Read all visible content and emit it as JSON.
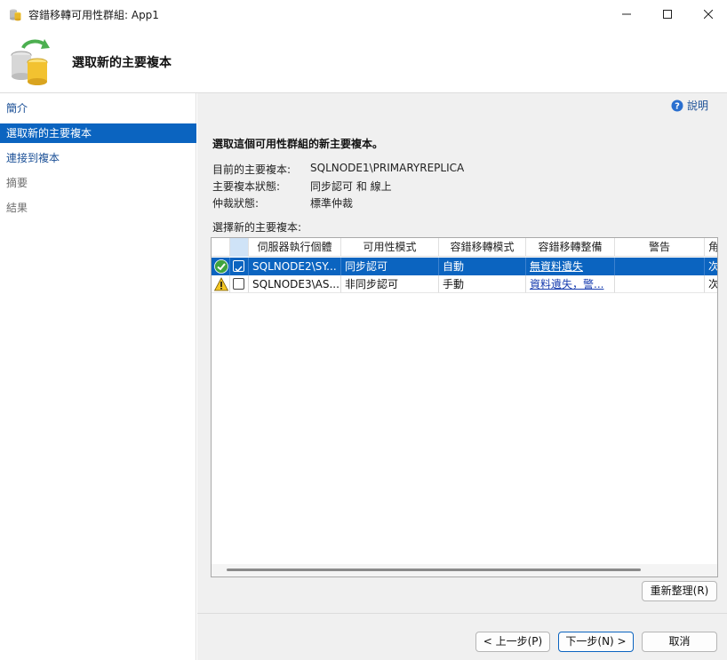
{
  "window": {
    "title": "容錯移轉可用性群組: App1",
    "minimize_glyph": "─",
    "maximize_glyph": "☐",
    "close_glyph": "✕"
  },
  "banner": {
    "title": "選取新的主要複本"
  },
  "nav": {
    "items": [
      {
        "label": "簡介",
        "state": "link"
      },
      {
        "label": "選取新的主要複本",
        "state": "active"
      },
      {
        "label": "連接到複本",
        "state": "link"
      },
      {
        "label": "摘要",
        "state": "disabled"
      },
      {
        "label": "結果",
        "state": "disabled"
      }
    ]
  },
  "help": {
    "label": "說明"
  },
  "content": {
    "heading": "選取這個可用性群組的新主要複本。",
    "info": [
      {
        "label": "目前的主要複本:",
        "value": "SQLNODE1\\PRIMARYREPLICA"
      },
      {
        "label": "主要複本狀態:",
        "value": "同步認可 和 線上"
      },
      {
        "label": "仲裁狀態:",
        "value": "標準仲裁"
      }
    ],
    "grid_label": "選擇新的主要複本:"
  },
  "grid": {
    "columns": [
      "",
      "",
      "伺服器執行個體",
      "可用性模式",
      "容錯移轉模式",
      "容錯移轉整備",
      "警告",
      "角"
    ],
    "rows": [
      {
        "status_icon": "success-check-icon",
        "checked": true,
        "server": "SQLNODE2\\SY...",
        "availability": "同步認可",
        "failover_mode": "自動",
        "readiness": "無資料遺失",
        "warning": "",
        "role": "次"
      },
      {
        "status_icon": "warning-triangle-icon",
        "checked": false,
        "server": "SQLNODE3\\AS...",
        "availability": "非同步認可",
        "failover_mode": "手動",
        "readiness": "資料遺失，警...",
        "warning": "",
        "role": "次"
      }
    ]
  },
  "buttons": {
    "refresh": "重新整理(R)",
    "back": "< 上一步(P)",
    "next": "下一步(N) >",
    "cancel": "取消"
  },
  "colors": {
    "accent": "#0b64c0",
    "link": "#1a4f96",
    "panel_bg": "#f0f0f0"
  }
}
